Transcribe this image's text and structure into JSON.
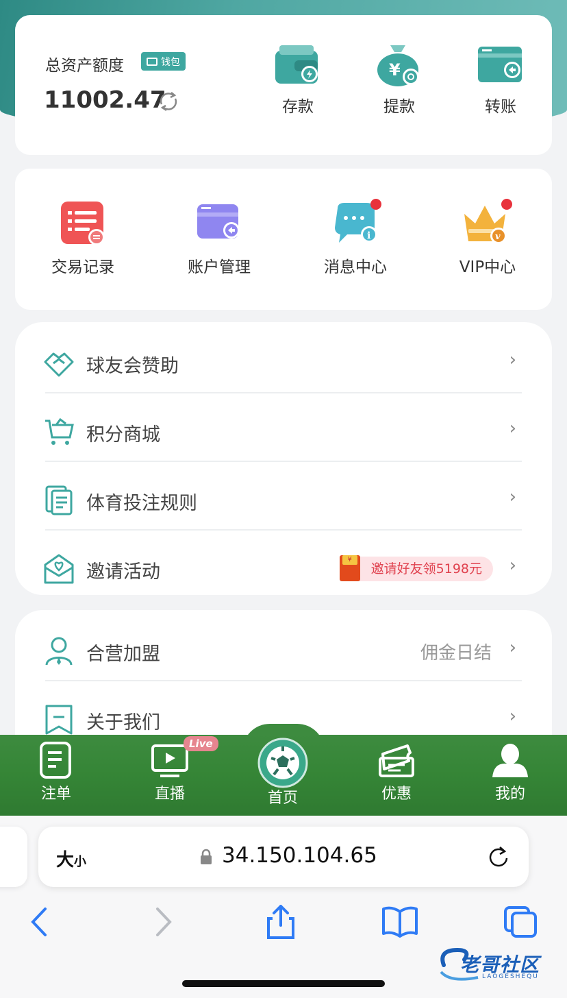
{
  "asset": {
    "label": "总资产额度",
    "wallet_badge": "钱包",
    "balance": "11002.47",
    "actions": [
      {
        "label": "存款",
        "icon": "deposit-wallet-icon"
      },
      {
        "label": "提款",
        "icon": "withdraw-moneybag-icon"
      },
      {
        "label": "转账",
        "icon": "transfer-card-icon"
      }
    ]
  },
  "grid": [
    {
      "label": "交易记录",
      "icon": "transaction-record-icon",
      "dot": false
    },
    {
      "label": "账户管理",
      "icon": "account-card-icon",
      "dot": false
    },
    {
      "label": "消息中心",
      "icon": "message-bubble-icon",
      "dot": true
    },
    {
      "label": "VIP中心",
      "icon": "vip-crown-icon",
      "dot": true
    }
  ],
  "menu": [
    {
      "label": "球友会赞助",
      "icon": "handshake-icon"
    },
    {
      "label": "积分商城",
      "icon": "shopping-cart-icon"
    },
    {
      "label": "体育投注规则",
      "icon": "document-rules-icon"
    },
    {
      "label": "邀请活动",
      "icon": "invite-envelope-icon",
      "pill": "邀请好友领5198元"
    }
  ],
  "menu2": [
    {
      "label": "合营加盟",
      "icon": "partner-person-icon",
      "right": "佣金日结"
    },
    {
      "label": "关于我们",
      "icon": "bookmark-icon"
    }
  ],
  "tabbar": [
    {
      "label": "注单",
      "icon": "bet-slip-icon"
    },
    {
      "label": "直播",
      "icon": "live-tv-icon",
      "badge": "Live"
    },
    {
      "label": "首页",
      "icon": "soccer-ball-icon"
    },
    {
      "label": "优惠",
      "icon": "coupon-ticket-icon"
    },
    {
      "label": "我的",
      "icon": "user-profile-icon"
    }
  ],
  "browser": {
    "text_size": "大",
    "text_size_small": "小",
    "url": "34.150.104.65"
  },
  "watermark": {
    "text": "老哥社区",
    "sub": "LAOGESHEQU"
  },
  "colors": {
    "teal": "#3ea7a0",
    "green_tab": "#3d8b3f",
    "red_dot": "#e8323c"
  }
}
